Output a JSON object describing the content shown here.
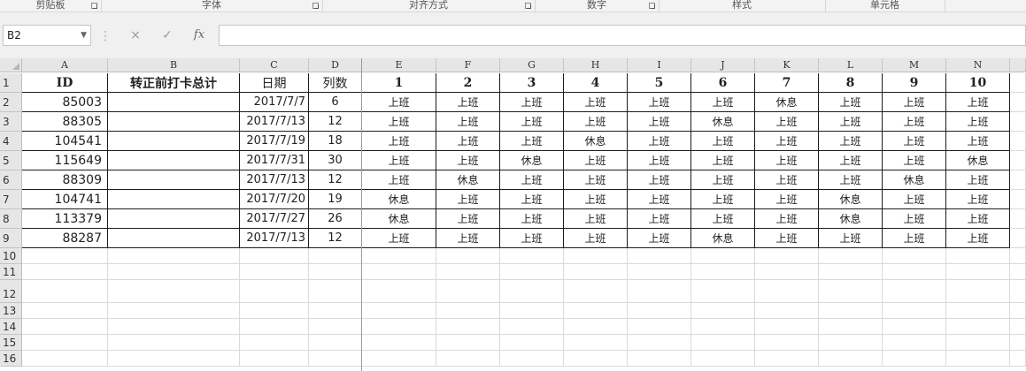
{
  "ribbon": {
    "groups": [
      {
        "label": "剪贴板",
        "launcher": true
      },
      {
        "label": "字体",
        "launcher": true
      },
      {
        "label": "对齐方式",
        "launcher": true
      },
      {
        "label": "数字",
        "launcher": true
      },
      {
        "label": "样式",
        "launcher": false
      },
      {
        "label": "单元格",
        "launcher": false
      }
    ]
  },
  "formula_bar": {
    "name_box": "B2",
    "cancel_icon": "×",
    "enter_icon": "✓",
    "fx_label": "fx",
    "formula": ""
  },
  "sheet": {
    "columns": [
      "A",
      "B",
      "C",
      "D",
      "E",
      "F",
      "G",
      "H",
      "I",
      "J",
      "K",
      "L",
      "M",
      "N"
    ],
    "row_numbers": [
      "1",
      "2",
      "3",
      "4",
      "5",
      "6",
      "7",
      "8",
      "9",
      "10",
      "11",
      "12",
      "13",
      "14",
      "15",
      "16"
    ],
    "header_row": [
      "ID",
      "转正前打卡总计",
      "日期",
      "列数",
      "1",
      "2",
      "3",
      "4",
      "5",
      "6",
      "7",
      "8",
      "9",
      "10"
    ],
    "rows": [
      {
        "id": "85003",
        "total": "",
        "date": "2017/7/7",
        "count": "6",
        "shifts": [
          "上班",
          "上班",
          "上班",
          "上班",
          "上班",
          "上班",
          "休息",
          "上班",
          "上班",
          "上班"
        ]
      },
      {
        "id": "88305",
        "total": "",
        "date": "2017/7/13",
        "count": "12",
        "shifts": [
          "上班",
          "上班",
          "上班",
          "上班",
          "上班",
          "休息",
          "上班",
          "上班",
          "上班",
          "上班"
        ]
      },
      {
        "id": "104541",
        "total": "",
        "date": "2017/7/19",
        "count": "18",
        "shifts": [
          "上班",
          "上班",
          "上班",
          "休息",
          "上班",
          "上班",
          "上班",
          "上班",
          "上班",
          "上班"
        ]
      },
      {
        "id": "115649",
        "total": "",
        "date": "2017/7/31",
        "count": "30",
        "shifts": [
          "上班",
          "上班",
          "休息",
          "上班",
          "上班",
          "上班",
          "上班",
          "上班",
          "上班",
          "休息"
        ]
      },
      {
        "id": "88309",
        "total": "",
        "date": "2017/7/13",
        "count": "12",
        "shifts": [
          "上班",
          "休息",
          "上班",
          "上班",
          "上班",
          "上班",
          "上班",
          "上班",
          "休息",
          "上班"
        ]
      },
      {
        "id": "104741",
        "total": "",
        "date": "2017/7/20",
        "count": "19",
        "shifts": [
          "休息",
          "上班",
          "上班",
          "上班",
          "上班",
          "上班",
          "上班",
          "休息",
          "上班",
          "上班"
        ]
      },
      {
        "id": "113379",
        "total": "",
        "date": "2017/7/27",
        "count": "26",
        "shifts": [
          "休息",
          "上班",
          "上班",
          "上班",
          "上班",
          "上班",
          "上班",
          "休息",
          "上班",
          "上班"
        ]
      },
      {
        "id": "88287",
        "total": "",
        "date": "2017/7/13",
        "count": "12",
        "shifts": [
          "上班",
          "上班",
          "上班",
          "上班",
          "上班",
          "休息",
          "上班",
          "上班",
          "上班",
          "上班"
        ]
      }
    ]
  }
}
